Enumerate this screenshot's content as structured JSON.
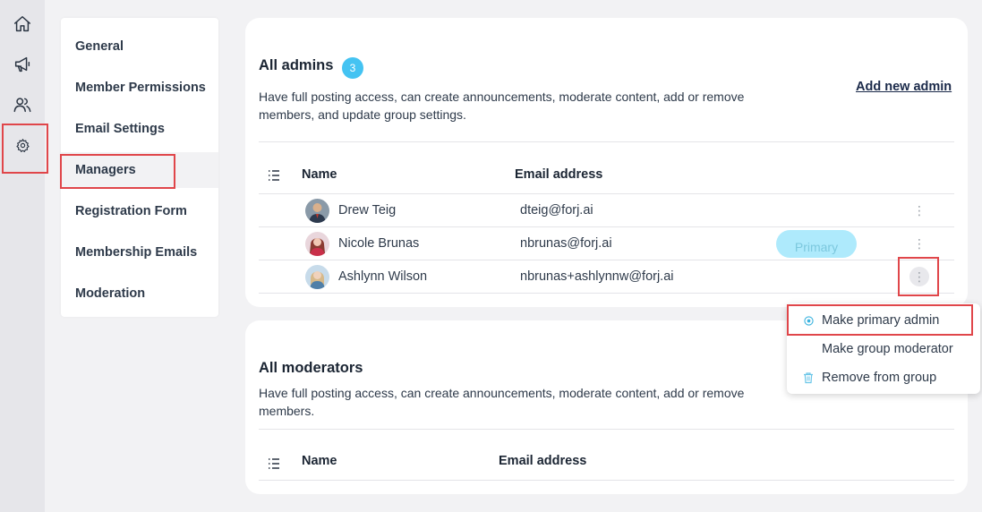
{
  "rail": {
    "icons": [
      "home-icon",
      "megaphone-icon",
      "users-icon",
      "gear-icon"
    ]
  },
  "menu": {
    "items": [
      {
        "label": "General"
      },
      {
        "label": "Member Permissions"
      },
      {
        "label": "Email Settings"
      },
      {
        "label": "Managers"
      },
      {
        "label": "Registration Form"
      },
      {
        "label": "Membership Emails"
      },
      {
        "label": "Moderation"
      }
    ],
    "active": "Managers"
  },
  "admins": {
    "title": "All admins",
    "count": "3",
    "description_line1": "Have full posting access, can create announcements, moderate content, add or remove",
    "description_line2": "members, and update group settings.",
    "add_link": "Add new admin",
    "columns": {
      "name": "Name",
      "email": "Email address"
    },
    "rows": [
      {
        "name": "Drew Teig",
        "email": "dteig@forj.ai",
        "badge": ""
      },
      {
        "name": "Nicole Brunas",
        "email": "nbrunas@forj.ai",
        "badge": "Primary"
      },
      {
        "name": "Ashlynn Wilson",
        "email": "nbrunas+ashlynnw@forj.ai",
        "badge": ""
      }
    ]
  },
  "moderators": {
    "title": "All moderators",
    "description_line1": "Have full posting access, can create announcements, moderate content, add or remove",
    "description_line2": "members.",
    "columns": {
      "name": "Name",
      "email": "Email address"
    }
  },
  "dropdown": {
    "items": [
      {
        "label": "Make primary admin",
        "icon": "target-icon"
      },
      {
        "label": "Make group moderator",
        "icon": ""
      },
      {
        "label": "Remove from group",
        "icon": "trash-icon"
      }
    ]
  },
  "colors": {
    "accent": "#44c3f2",
    "primary_pill": "#aeeafc",
    "highlight": "#e0464a"
  }
}
